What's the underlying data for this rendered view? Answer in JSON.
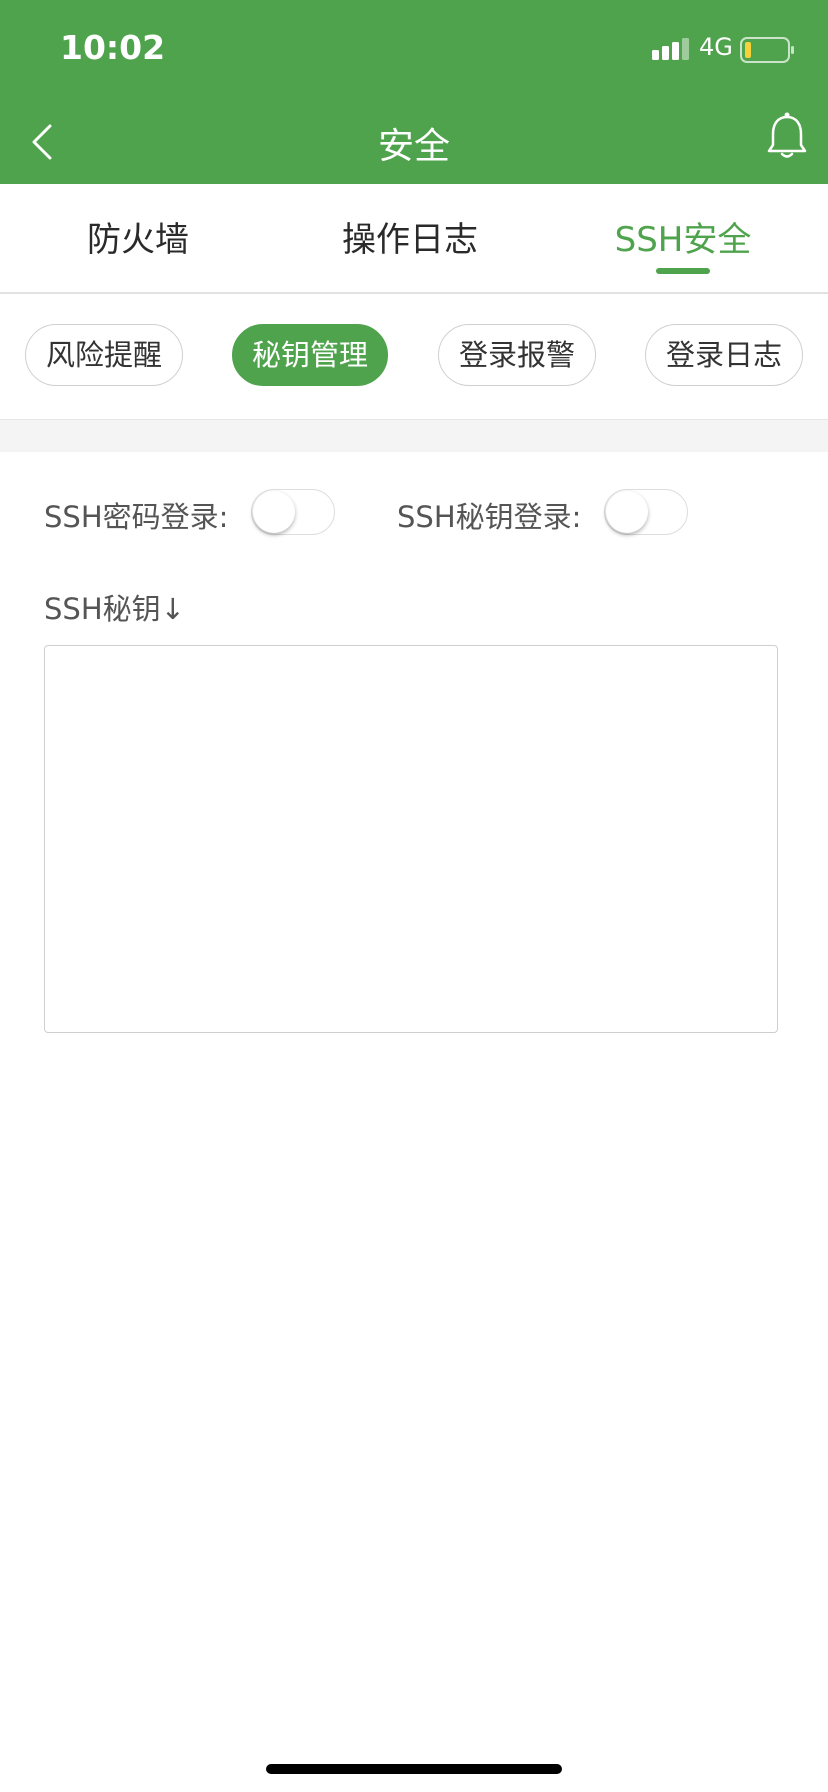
{
  "status_bar": {
    "time": "10:02",
    "network": "4G"
  },
  "header": {
    "title": "安全"
  },
  "tabs": [
    {
      "label": "防火墙"
    },
    {
      "label": "操作日志"
    },
    {
      "label": "SSH安全"
    }
  ],
  "chips": [
    {
      "label": "风险提醒"
    },
    {
      "label": "秘钥管理"
    },
    {
      "label": "登录报警"
    },
    {
      "label": "登录日志"
    }
  ],
  "ssh": {
    "password_login_label": "SSH密码登录:",
    "key_login_label": "SSH秘钥登录:",
    "key_section_label": "SSH秘钥↓",
    "key_value": ""
  },
  "colors": {
    "accent": "#4fa34c",
    "battery_level": "#f5d13a"
  },
  "icons": {
    "back": "back-chevron-icon",
    "bell": "bell-icon",
    "signal": "signal-icon",
    "battery": "battery-icon"
  }
}
